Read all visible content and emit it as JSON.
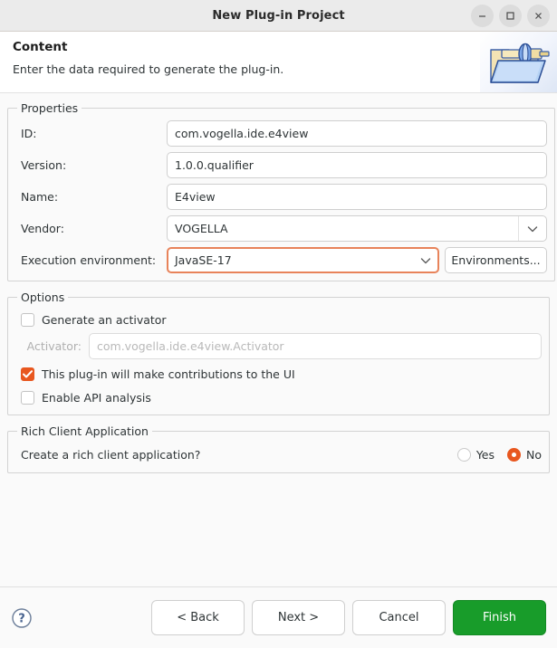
{
  "window": {
    "title": "New Plug-in Project",
    "controls": {
      "minimize": "minimize-icon",
      "maximize": "maximize-icon",
      "close": "close-icon"
    }
  },
  "header": {
    "title": "Content",
    "subtitle": "Enter the data required to generate the plug-in.",
    "icon": "plugin-folder-icon"
  },
  "properties": {
    "legend": "Properties",
    "fields": [
      {
        "label": "ID:",
        "value": "com.vogella.ide.e4view",
        "type": "text",
        "name": "id"
      },
      {
        "label": "Version:",
        "value": "1.0.0.qualifier",
        "type": "text",
        "name": "version"
      },
      {
        "label": "Name:",
        "value": "E4view",
        "type": "text",
        "name": "name"
      },
      {
        "label": "Vendor:",
        "value": "VOGELLA",
        "type": "combo",
        "name": "vendor"
      }
    ],
    "execution_environment": {
      "label": "Execution environment:",
      "value": "JavaSE-17",
      "focused": true,
      "button_label": "Environments..."
    }
  },
  "options": {
    "legend": "Options",
    "generate_activator": {
      "label": "Generate an activator",
      "checked": false
    },
    "activator": {
      "label": "Activator:",
      "placeholder": "com.vogella.ide.e4view.Activator",
      "value": "",
      "disabled": true
    },
    "ui_contributions": {
      "label": "This plug-in will make contributions to the UI",
      "checked": true
    },
    "api_analysis": {
      "label": "Enable API analysis",
      "checked": false
    }
  },
  "rich_client": {
    "legend": "Rich Client Application",
    "question": "Create a rich client application?",
    "options": [
      {
        "label": "Yes",
        "selected": false
      },
      {
        "label": "No",
        "selected": true
      }
    ]
  },
  "footer": {
    "help_icon": "help-icon",
    "buttons": [
      {
        "label": "< Back",
        "name": "back",
        "primary": false
      },
      {
        "label": "Next >",
        "name": "next",
        "primary": false
      },
      {
        "label": "Cancel",
        "name": "cancel",
        "primary": false
      },
      {
        "label": "Finish",
        "name": "finish",
        "primary": true
      }
    ]
  },
  "colors": {
    "accent_orange": "#e8571f",
    "focus_orange": "#e8835a",
    "finish_green": "#189c2a",
    "titlebar_bg": "#ebebeb",
    "content_bg": "#fafafa"
  }
}
